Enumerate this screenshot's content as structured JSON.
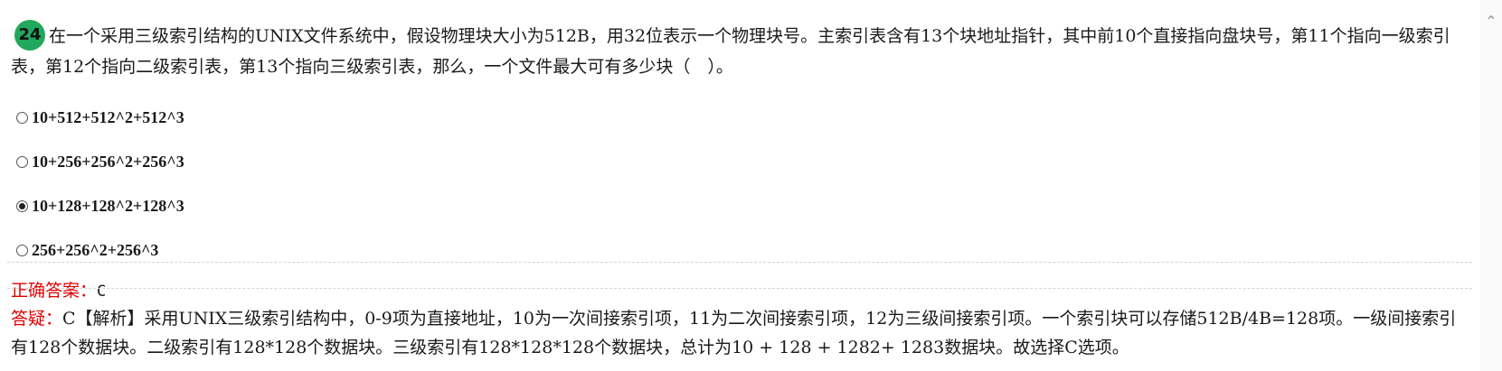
{
  "question": {
    "number": "24",
    "text": "在一个采用三级索引结构的UNIX文件系统中，假设物理块大小为512B，用32位表示一个物理块号。主索引表含有13个块地址指针，其中前10个直接指向盘块号，第11个指向一级索引表，第12个指向二级索引表，第13个指向三级索引表，那么，一个文件最大可有多少块（　）。"
  },
  "options": [
    {
      "label": "10+512+512^2+512^3",
      "selected": false
    },
    {
      "label": "10+256+256^2+256^3",
      "selected": false
    },
    {
      "label": "10+128+128^2+128^3",
      "selected": true
    },
    {
      "label": "256+256^2+256^3",
      "selected": false
    }
  ],
  "answer": {
    "label": "正确答案：",
    "value": "C"
  },
  "explanation": {
    "label": "答疑：",
    "text": "C【解析】采用UNIX三级索引结构中，0-9项为直接地址，10为一次间接索引项，11为二次间接索引项，12为三级间接索引项。一个索引块可以存储512B/4B=128项。一级间接索引有128个数据块。二级索引有128*128个数据块。三级索引有128*128*128个数据块，总计为10 + 128 + 1282+ 1283数据块。故选择C选项。"
  },
  "scrollbar": {
    "up_icon": "chevron-up-icon"
  },
  "colors": {
    "badge": "#22a85c",
    "answer_label": "#e00000"
  }
}
